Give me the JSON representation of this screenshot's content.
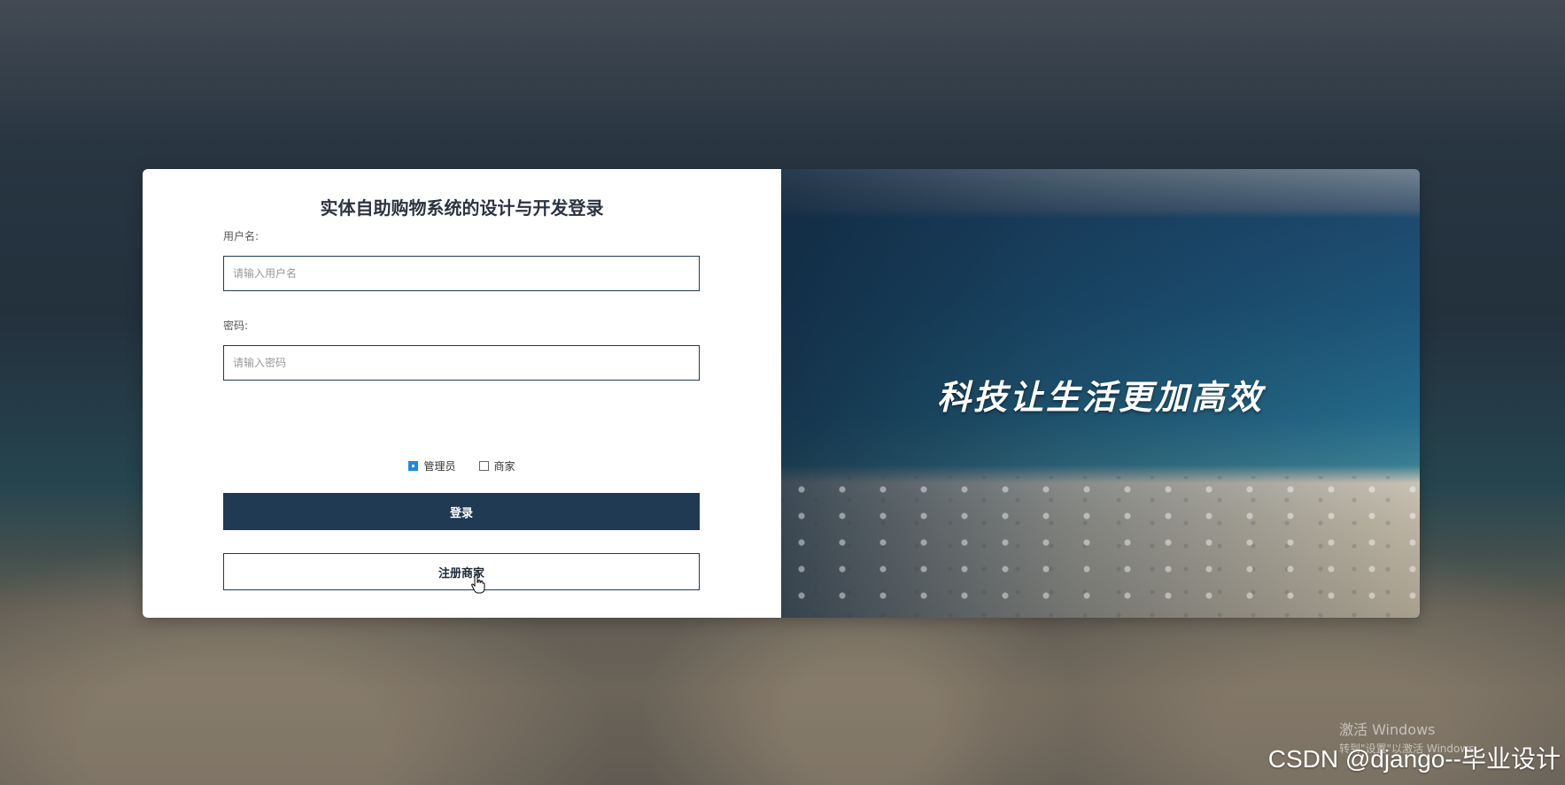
{
  "login": {
    "title": "实体自助购物系统的设计与开发登录",
    "username_label": "用户名:",
    "username_placeholder": "请输入用户名",
    "password_label": "密码:",
    "password_placeholder": "请输入密码",
    "roles": [
      {
        "label": "管理员",
        "checked": true
      },
      {
        "label": "商家",
        "checked": false
      }
    ],
    "login_button": "登录",
    "register_button": "注册商家"
  },
  "banner": {
    "slogan": "科技让生活更加高效"
  },
  "watermarks": {
    "windows_title": "激活 Windows",
    "windows_sub": "转到\"设置\"以激活 Windows。",
    "csdn": "CSDN @django--毕业设计"
  },
  "colors": {
    "primary": "#1f3a52",
    "checkbox_accent": "#1e88e5"
  },
  "icons": {
    "cursor": "hand-pointer-icon"
  }
}
